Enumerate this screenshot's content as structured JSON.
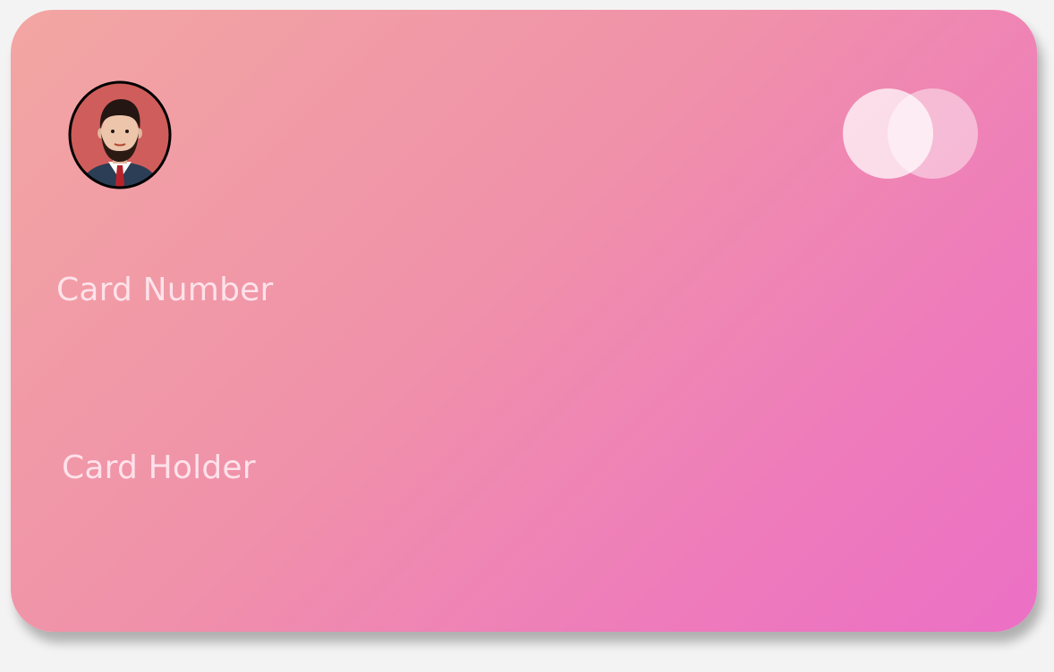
{
  "card": {
    "number_label": "Card Number",
    "holder_label": "Card Holder"
  },
  "icons": {
    "avatar": "user-avatar-icon",
    "brand": "card-network-logo"
  },
  "colors": {
    "card_gradient_start": "#f2a6a2",
    "card_gradient_mid": "#ee7cbb",
    "card_gradient_end": "#ec6fc5",
    "label_text": "#ffe8f0"
  }
}
